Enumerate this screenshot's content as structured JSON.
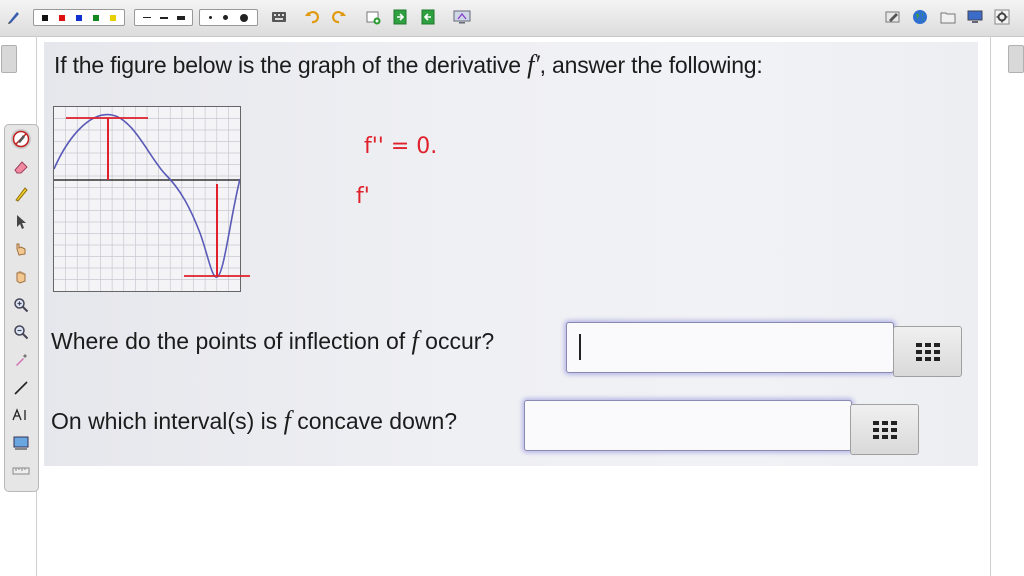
{
  "question": {
    "heading_prefix": "If the figure below is the graph of the derivative",
    "heading_symbol": "f′",
    "heading_suffix": ", answer the following:",
    "q1_text": "Where do the points of inflection of",
    "q1_symbol": "f",
    "q1_suffix": "occur?",
    "q2_text": "On which interval(s) is",
    "q2_symbol": "f",
    "q2_suffix": "concave down?"
  },
  "annotations": {
    "line1": "f'' = 0.",
    "line2": "f'"
  },
  "answers": [
    {
      "value": ""
    },
    {
      "value": ""
    }
  ],
  "colors": {
    "annotation": "#e0202a",
    "curve": "#5a5ab8",
    "input_glow": "#8c8cdc"
  },
  "icons": {
    "toolbar": [
      "pen-icon",
      "color-palette-icon",
      "line-style-icon",
      "dot-size-icon",
      "keyboard-icon",
      "undo-icon",
      "redo-icon",
      "add-page-icon",
      "import-icon",
      "export-icon",
      "screen-share-icon",
      "edit-icon",
      "globe-icon",
      "folder-icon",
      "monitor-icon",
      "settings-icon"
    ],
    "palette": [
      "no-pen-icon",
      "eraser-icon",
      "highlighter-icon",
      "pointer-icon",
      "hand-pointer-icon",
      "hand-icon",
      "zoom-in-icon",
      "zoom-out-icon",
      "eyedropper-icon",
      "line-tool-icon",
      "text-tool-icon",
      "screenshot-icon",
      "ruler-icon"
    ]
  }
}
